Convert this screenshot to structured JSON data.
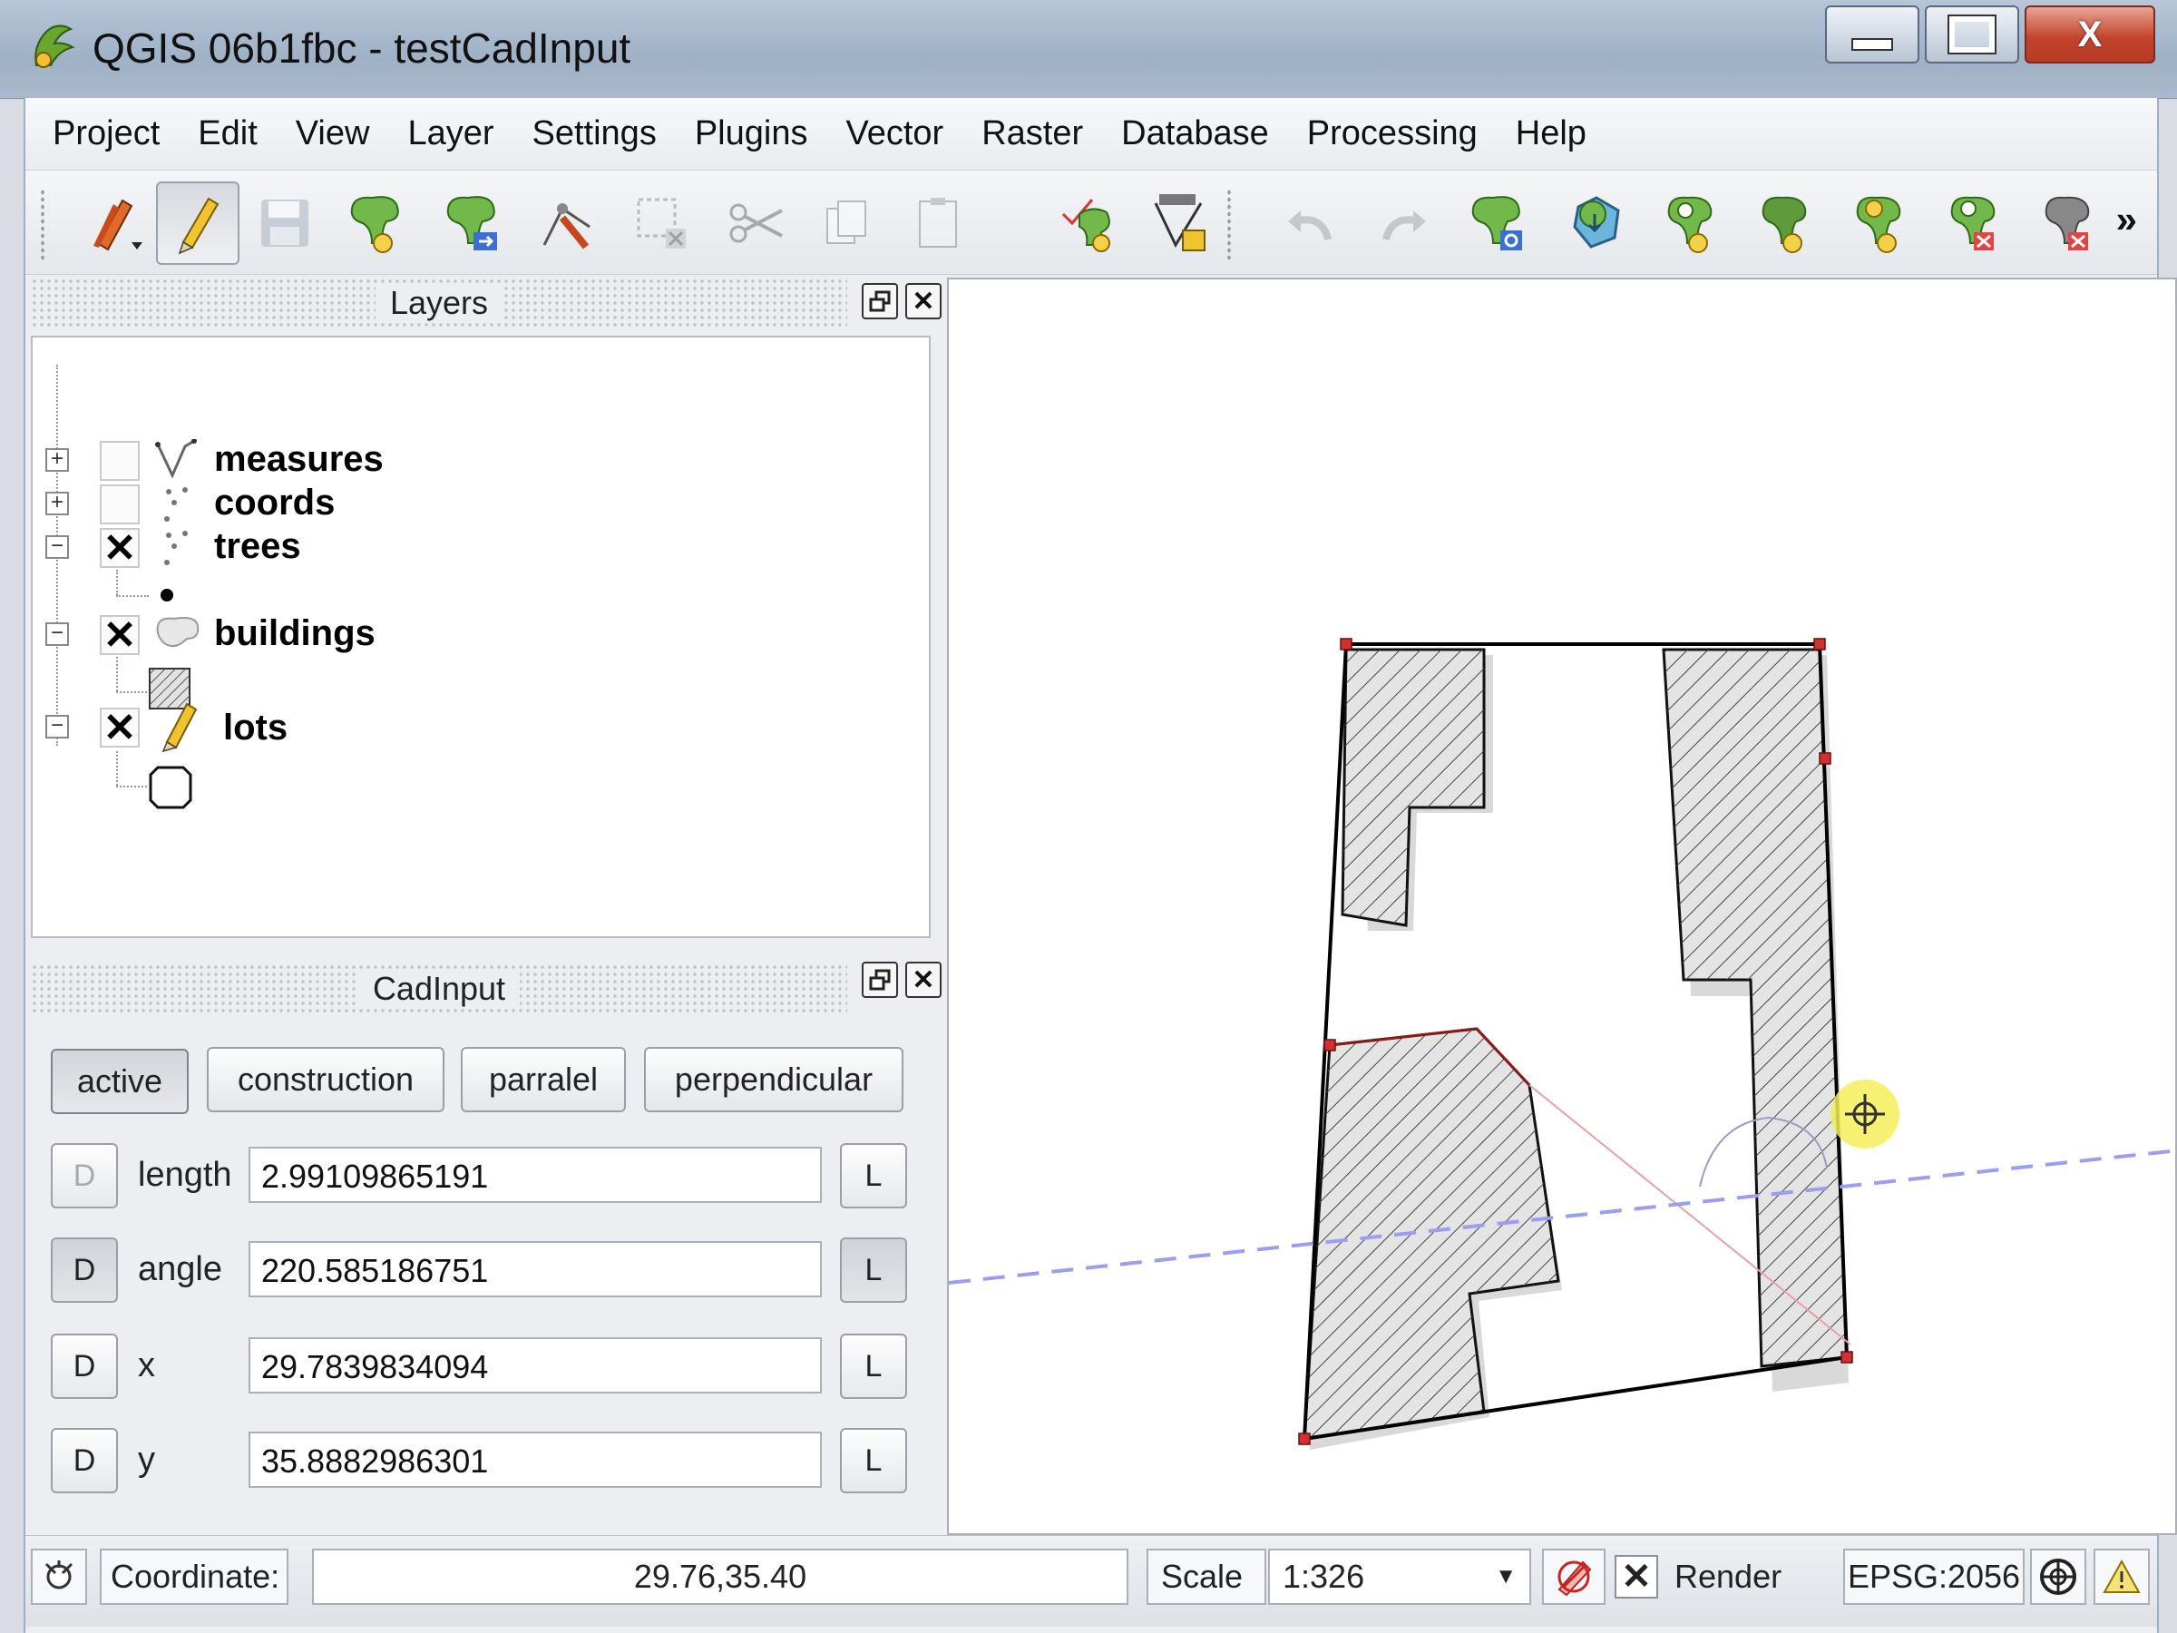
{
  "window": {
    "title": "QGIS 06b1fbc - testCadInput",
    "minimize_icon": "minimize-icon",
    "maximize_icon": "maximize-icon",
    "close_label": "X"
  },
  "menu": [
    "Project",
    "Edit",
    "View",
    "Layer",
    "Settings",
    "Plugins",
    "Vector",
    "Raster",
    "Database",
    "Processing",
    "Help"
  ],
  "toolbar": {
    "more_label": "»",
    "icons": [
      "current-edits-icon",
      "toggle-editing-icon",
      "save-edits-icon",
      "add-feature-icon",
      "move-feature-icon",
      "node-tool-icon",
      "delete-selected-icon",
      "cut-features-icon",
      "copy-features-icon",
      "paste-features-icon",
      "add-ring-icon",
      "reshape-icon",
      "undo-icon",
      "redo-icon",
      "simplify-feature-icon",
      "rotate-feature-icon",
      "add-part-icon",
      "fill-ring-icon",
      "offset-curve-icon",
      "delete-ring-icon",
      "delete-part-icon"
    ]
  },
  "layers_panel": {
    "title": "Layers",
    "layers": [
      {
        "name": "measures",
        "checked": false,
        "expanded": false
      },
      {
        "name": "coords",
        "checked": false,
        "expanded": false
      },
      {
        "name": "trees",
        "checked": true,
        "expanded": true
      },
      {
        "name": "buildings",
        "checked": true,
        "expanded": true
      },
      {
        "name": "lots",
        "checked": true,
        "expanded": true
      }
    ],
    "check_mark": "✕"
  },
  "cad_panel": {
    "title": "CadInput",
    "buttons": [
      "active",
      "construction",
      "parralel",
      "perpendicular"
    ],
    "fields": [
      {
        "label": "length",
        "value": "2.99109865191",
        "d": "D",
        "l": "L"
      },
      {
        "label": "angle",
        "value": "220.585186751",
        "d": "D",
        "l": "L"
      },
      {
        "label": "x",
        "value": "29.7839834094",
        "d": "D",
        "l": "L"
      },
      {
        "label": "y",
        "value": "35.8882986301",
        "d": "D",
        "l": "L"
      }
    ]
  },
  "statusbar": {
    "coordinate_label": "Coordinate:",
    "coordinate_value": "29.76,35.40",
    "scale_label": "Scale",
    "scale_value": "1:326",
    "render_label": "Render",
    "render_checked": "✕",
    "crs": "EPSG:2056"
  },
  "colors": {
    "accent_cursor": "#f4ef5a",
    "guide_line": "#9c9cf0",
    "vertex": "#d23030",
    "construction_line": "#e8a0a8"
  }
}
